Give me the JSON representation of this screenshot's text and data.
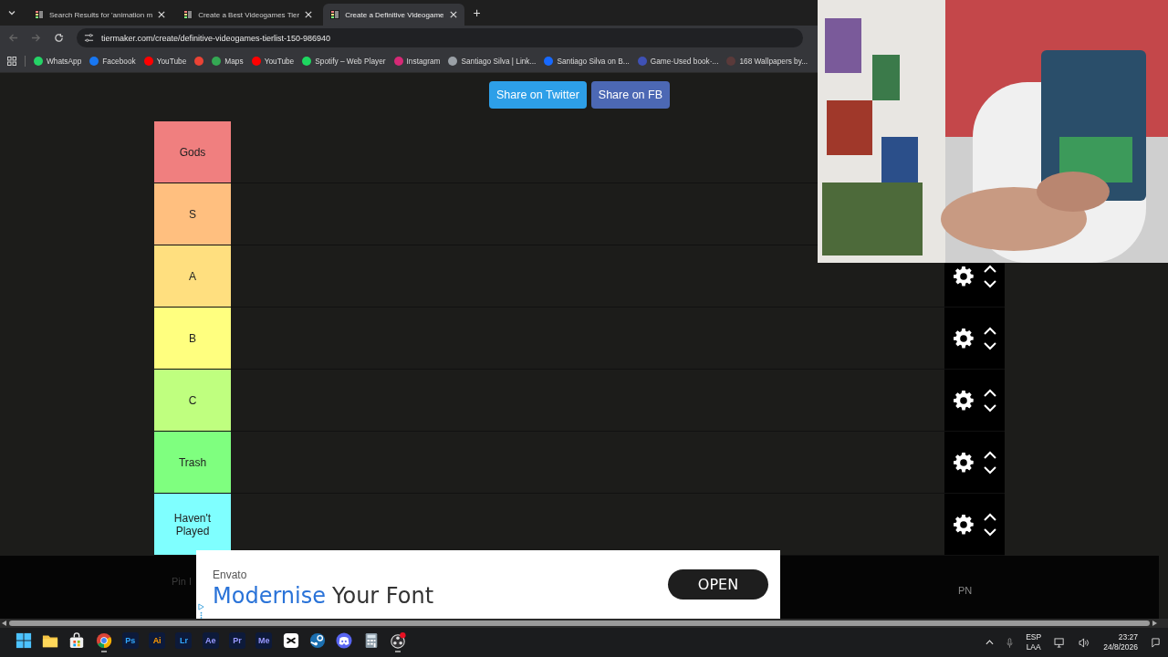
{
  "browser": {
    "tabs": [
      {
        "title": "Search Results for 'animation m",
        "selected": false
      },
      {
        "title": "Create a Best Videogames Tier",
        "selected": false
      },
      {
        "title": "Create a Definitive Videogame",
        "selected": true
      }
    ],
    "new_tab": "+",
    "url": "tiermaker.com/create/definitive-videogames-tierlist-150-986940",
    "bookmarks": [
      {
        "label": "WhatsApp",
        "color": "#25d366"
      },
      {
        "label": "Facebook",
        "color": "#1877f2"
      },
      {
        "label": "YouTube",
        "color": "#ff0000"
      },
      {
        "color": "#ea4335"
      },
      {
        "label": "Maps",
        "color": "#34a853"
      },
      {
        "label": "YouTube",
        "color": "#ff0000"
      },
      {
        "label": "Spotify – Web Player",
        "color": "#1ed760"
      },
      {
        "label": "Instagram",
        "color": "#d62976"
      },
      {
        "label": "Santiago Silva | Link...",
        "color": "#9aa0a6"
      },
      {
        "label": "Santiago Silva on B...",
        "color": "#1769ff"
      },
      {
        "label": "Game·Used book·...",
        "color": "#3f51b5"
      },
      {
        "label": "168 Wallpapers by...",
        "color": "#5a3a3a"
      }
    ]
  },
  "page": {
    "share_buttons": [
      {
        "label": "Share on Twitter",
        "color": "#2d9fe8"
      },
      {
        "label": "Share on FB",
        "color": "#4c68b4"
      }
    ],
    "tiers": [
      {
        "label": "Gods",
        "color": "#f07f7f"
      },
      {
        "label": "S",
        "color": "#ffbf7f"
      },
      {
        "label": "A",
        "color": "#ffdf7f",
        "controls": true
      },
      {
        "label": "B",
        "color": "#ffff7f",
        "controls": true
      },
      {
        "label": "C",
        "color": "#bfff7f",
        "controls": true
      },
      {
        "label": "Trash",
        "color": "#7fff7f",
        "controls": true
      },
      {
        "label": "Haven't Played",
        "color": "#7fffff",
        "controls": true
      }
    ],
    "behind_texts": [
      "Pin I",
      "PN"
    ],
    "ad": {
      "advertiser": "Envato",
      "headline_highlight": "Modernise",
      "headline_rest": "Your Font",
      "button": "OPEN"
    }
  },
  "taskbar": {
    "apps": [
      {
        "kind": "start",
        "running": false
      },
      {
        "kind": "folder",
        "running": false
      },
      {
        "kind": "store",
        "running": false
      },
      {
        "kind": "chrome",
        "running": true
      },
      {
        "kind": "badge",
        "label": "Ps",
        "color": "#31a8ff",
        "running": false
      },
      {
        "kind": "badge",
        "label": "Ai",
        "color": "#ff9a00",
        "running": false
      },
      {
        "kind": "badge",
        "label": "Lr",
        "color": "#31a8ff",
        "running": false
      },
      {
        "kind": "badge",
        "label": "Ae",
        "color": "#9999ff",
        "running": false
      },
      {
        "kind": "badge",
        "label": "Pr",
        "color": "#9999ff",
        "running": false
      },
      {
        "kind": "badge",
        "label": "Me",
        "color": "#9999ff",
        "running": false
      },
      {
        "kind": "capcut",
        "running": false
      },
      {
        "kind": "steam",
        "running": false
      },
      {
        "kind": "discord",
        "running": false
      },
      {
        "kind": "calculator",
        "running": false
      },
      {
        "kind": "obs",
        "running": true
      }
    ],
    "language": [
      "ESP",
      "LAA"
    ],
    "time": "23:27",
    "date": "24/8/2026"
  }
}
